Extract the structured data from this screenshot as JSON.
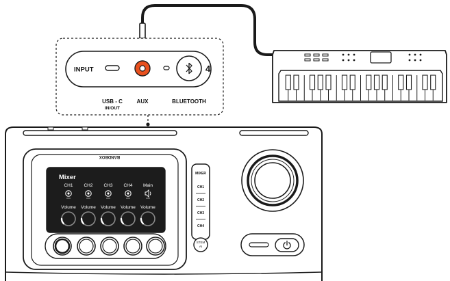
{
  "io_panel": {
    "input_label": "INPUT",
    "usb_label_line1": "USB - C",
    "usb_label_line2": "IN/OUT",
    "aux_label": "AUX",
    "bluetooth_label": "BLUETOOTH",
    "bluetooth_badge": "4"
  },
  "device": {
    "brand": "BANDBOX",
    "mixer_title": "Mixer",
    "channels": [
      {
        "label": "CH1",
        "knob_label": "Volume"
      },
      {
        "label": "CH2",
        "knob_label": "Volume"
      },
      {
        "label": "CH3",
        "knob_label": "Volume"
      },
      {
        "label": "CH4",
        "knob_label": "Volume"
      },
      {
        "label": "Main",
        "knob_label": "Volume"
      }
    ],
    "side_strip": {
      "title": "MIXER",
      "items": [
        "CH1",
        "CH2",
        "CH3",
        "CH4"
      ],
      "stem_label_line1": "STEM",
      "stem_label_line2": "AI"
    }
  },
  "colors": {
    "aux_jack": "#e8501e",
    "screen": "#1c1c1c",
    "line": "#1a1a1a"
  }
}
